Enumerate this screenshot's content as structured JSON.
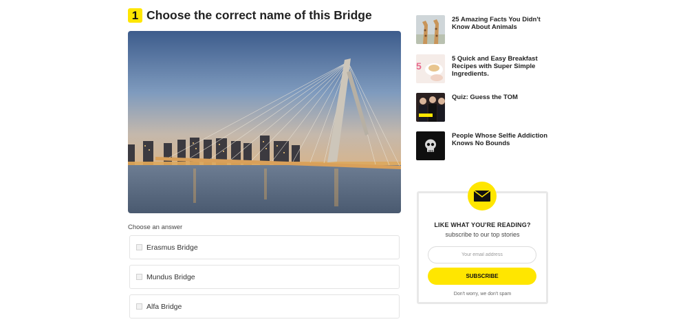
{
  "question": {
    "number": "1",
    "title": "Choose the correct name of this Bridge",
    "image_alt": "bridge photo",
    "choose_label": "Choose an answer",
    "answers": [
      {
        "label": "Erasmus Bridge"
      },
      {
        "label": "Mundus Bridge"
      },
      {
        "label": "Alfa Bridge"
      }
    ]
  },
  "sidebar": {
    "articles": [
      {
        "title": "25 Amazing Facts You Didn't Know About Animals",
        "thumb_icon": "giraffe-photo"
      },
      {
        "title": "5 Quick and Easy Breakfast Recipes with Super Simple Ingredients.",
        "thumb_icon": "breakfast-photo"
      },
      {
        "title": "Quiz: Guess the TOM",
        "thumb_icon": "celebrities-photo"
      },
      {
        "title": "People Whose Selfie Addiction Knows No Bounds",
        "thumb_icon": "skull-icon"
      }
    ],
    "newsletter": {
      "icon": "envelope-icon",
      "heading": "LIKE WHAT YOU'RE READING?",
      "subheading": "subscribe to our top stories",
      "email_placeholder": "Your email address",
      "button_label": "SUBSCRIBE",
      "note": "Don't worry, we don't spam",
      "accent_color": "#ffe600"
    }
  }
}
